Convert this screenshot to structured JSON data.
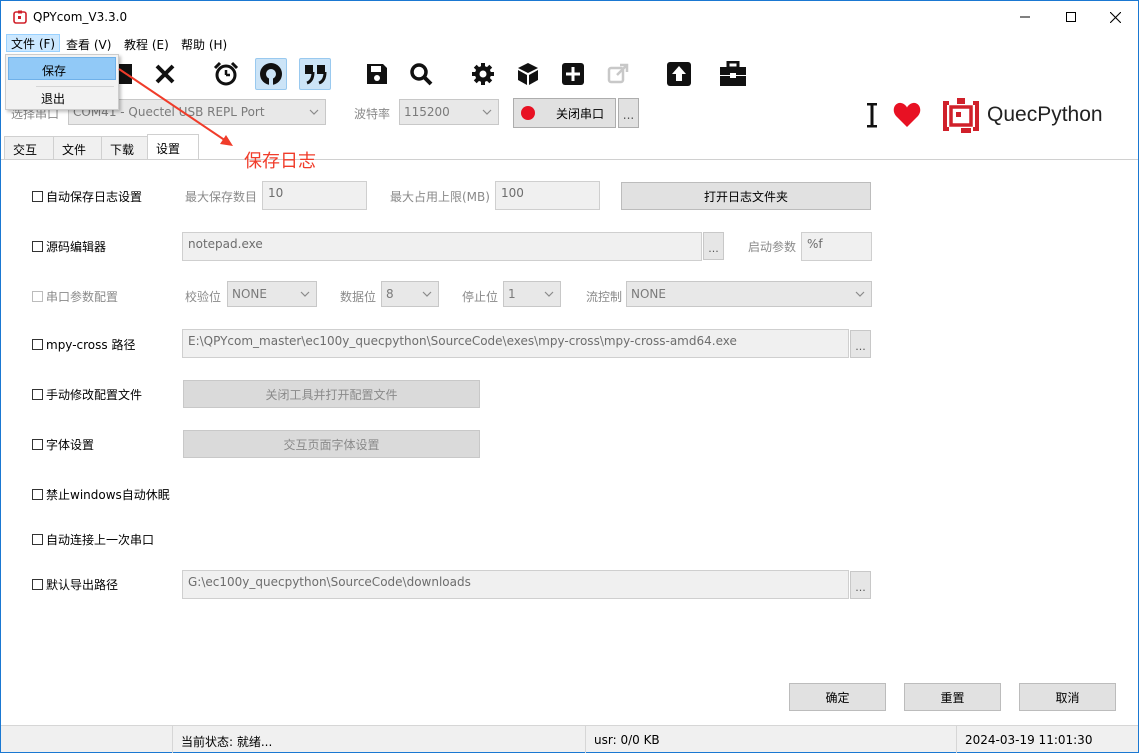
{
  "window": {
    "title": "QPYcom_V3.3.0",
    "accent": "#1a78d2"
  },
  "menubar": {
    "items": [
      {
        "label": "文件 (F)"
      },
      {
        "label": "查看 (V)"
      },
      {
        "label": "教程 (E)"
      },
      {
        "label": "帮助 (H)"
      }
    ]
  },
  "file_menu": {
    "items": [
      {
        "label": "保存",
        "highlighted": true
      },
      {
        "label": "退出",
        "highlighted": false
      }
    ]
  },
  "toolbar": {
    "icons": [
      "folder-icon",
      "close-icon",
      "alarm-clock-icon",
      "smiley-icon",
      "quote-icon",
      "save-icon",
      "search-icon",
      "gear-icon",
      "cube-icon",
      "plus-square-icon",
      "external-link-icon",
      "upload-icon",
      "toolbox-icon"
    ]
  },
  "port": {
    "select_label": "选择串口",
    "port_value": "COM41 - Quectel USB REPL Port",
    "baud_label": "波特率",
    "baud_value": "115200",
    "toggle_button": "关闭串口",
    "more_button": "...",
    "status_color": "#e81123"
  },
  "brand": {
    "name": "QuecPython",
    "heart_color": "#e81123"
  },
  "tabs": [
    {
      "label": "交互"
    },
    {
      "label": "文件"
    },
    {
      "label": "下载"
    },
    {
      "label": "设置"
    }
  ],
  "selected_tab": "设置",
  "annotation": {
    "text": "保存日志",
    "color": "#f03c2a"
  },
  "settings": {
    "auto_save_log": {
      "label": "自动保存日志设置",
      "checked": false,
      "max_count_label": "最大保存数目",
      "max_count": "10",
      "max_size_label": "最大占用上限(MB)",
      "max_size": "100",
      "open_folder_button": "打开日志文件夹"
    },
    "source_editor": {
      "label": "源码编辑器",
      "checked": false,
      "value": "notepad.exe",
      "dots": "...",
      "param_label": "启动参数",
      "param_value": "%f"
    },
    "serial_params": {
      "label": "串口参数配置",
      "checked": false,
      "parity_label": "校验位",
      "parity": "NONE",
      "databits_label": "数据位",
      "databits": "8",
      "stopbits_label": "停止位",
      "stopbits": "1",
      "flow_label": "流控制",
      "flow": "NONE"
    },
    "mpy_cross": {
      "label": "mpy-cross 路径",
      "checked": false,
      "value": "E:\\QPYcom_master\\ec100y_quecpython\\SourceCode\\exes\\mpy-cross\\mpy-cross-amd64.exe",
      "dots": "..."
    },
    "manual_config": {
      "label": "手动修改配置文件",
      "checked": false,
      "button": "关闭工具并打开配置文件"
    },
    "font_settings": {
      "label": "字体设置",
      "checked": false,
      "button": "交互页面字体设置"
    },
    "disable_sleep": {
      "label": "禁止windows自动休眠",
      "checked": false
    },
    "auto_connect": {
      "label": "自动连接上一次串口",
      "checked": false
    },
    "export_path": {
      "label": "默认导出路径",
      "checked": false,
      "value": "G:\\ec100y_quecpython\\SourceCode\\downloads",
      "dots": "..."
    }
  },
  "dialog_buttons": {
    "ok": "确定",
    "reset": "重置",
    "cancel": "取消"
  },
  "statusbar": {
    "state": "当前状态: 就绪...",
    "usr": "usr: 0/0 KB",
    "datetime": "2024-03-19 11:01:30"
  }
}
